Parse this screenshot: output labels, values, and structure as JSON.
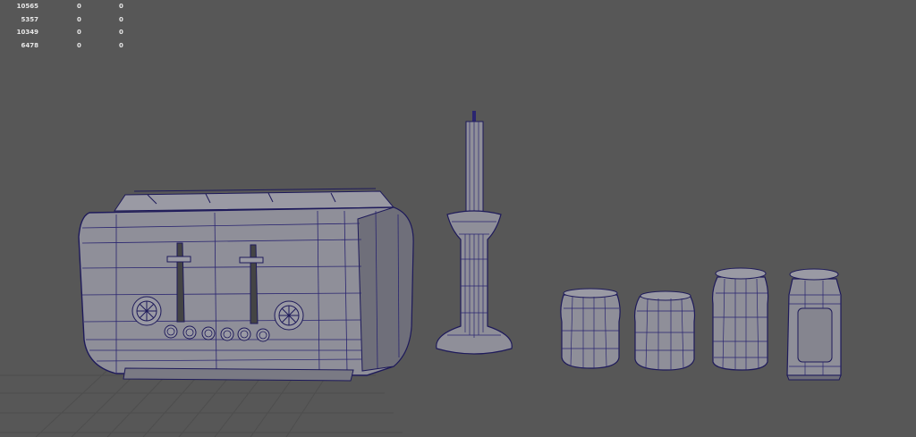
{
  "hud": {
    "rows": [
      {
        "c1": "10565",
        "c2": "0",
        "c3": "0"
      },
      {
        "c1": "5357",
        "c2": "0",
        "c3": "0"
      },
      {
        "c1": "10349",
        "c2": "0",
        "c3": "0"
      },
      {
        "c1": "6478",
        "c2": "0",
        "c3": "0"
      }
    ]
  },
  "scene": {
    "objects": [
      "toaster",
      "candlestick",
      "jar",
      "jar",
      "jar",
      "jar"
    ],
    "background_color": "#575757",
    "wire_color": "#1e1a5a",
    "surface_color": "#8f8f99"
  }
}
